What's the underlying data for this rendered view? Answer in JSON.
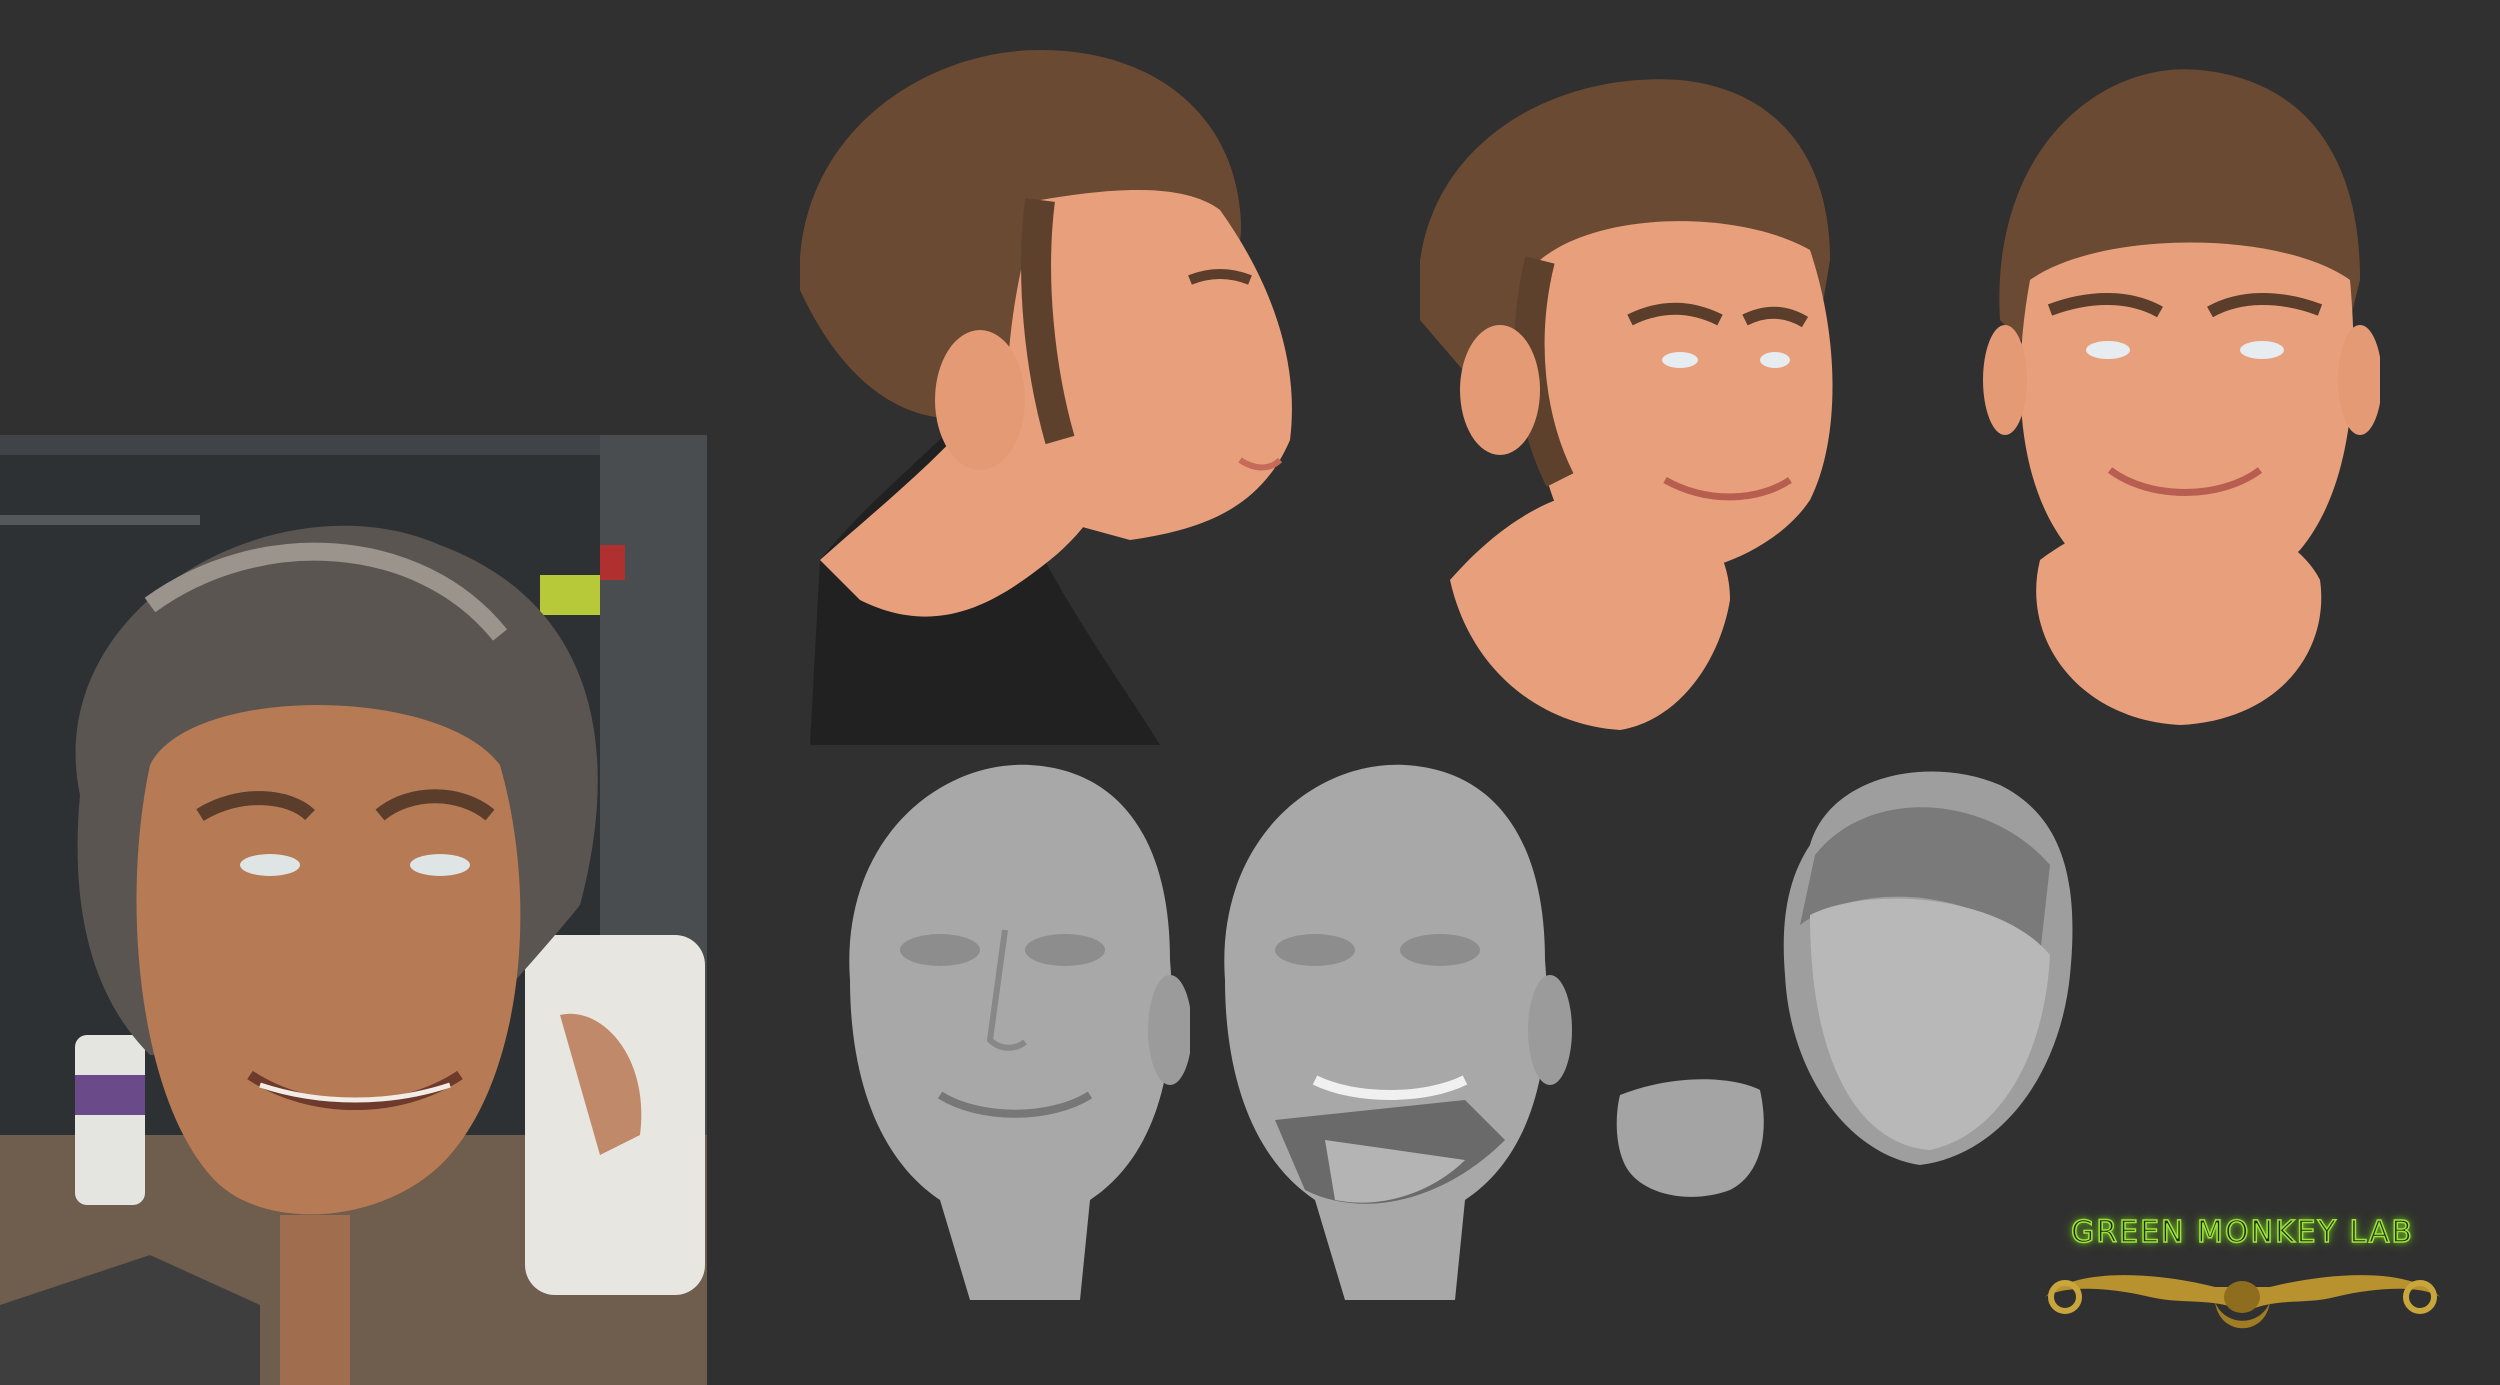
{
  "logo": {
    "text": "GREEN MONKEY LAB",
    "glow_color": "#9ee23a",
    "ornament_color": "#b8922e"
  },
  "colors": {
    "background": "#303030",
    "skin": "#e8a07c",
    "hair": "#6b4a33",
    "clay": "#a8a8a8"
  },
  "panels": {
    "photo": "workshop-photo-of-finished-puppet-head",
    "renders_colored": [
      "profile-view",
      "three-quarter-view",
      "front-view"
    ],
    "renders_clay": [
      "clay-head-closed-mouth",
      "clay-head-open-mouth",
      "jaw-piece",
      "head-shell-back-piece"
    ]
  }
}
